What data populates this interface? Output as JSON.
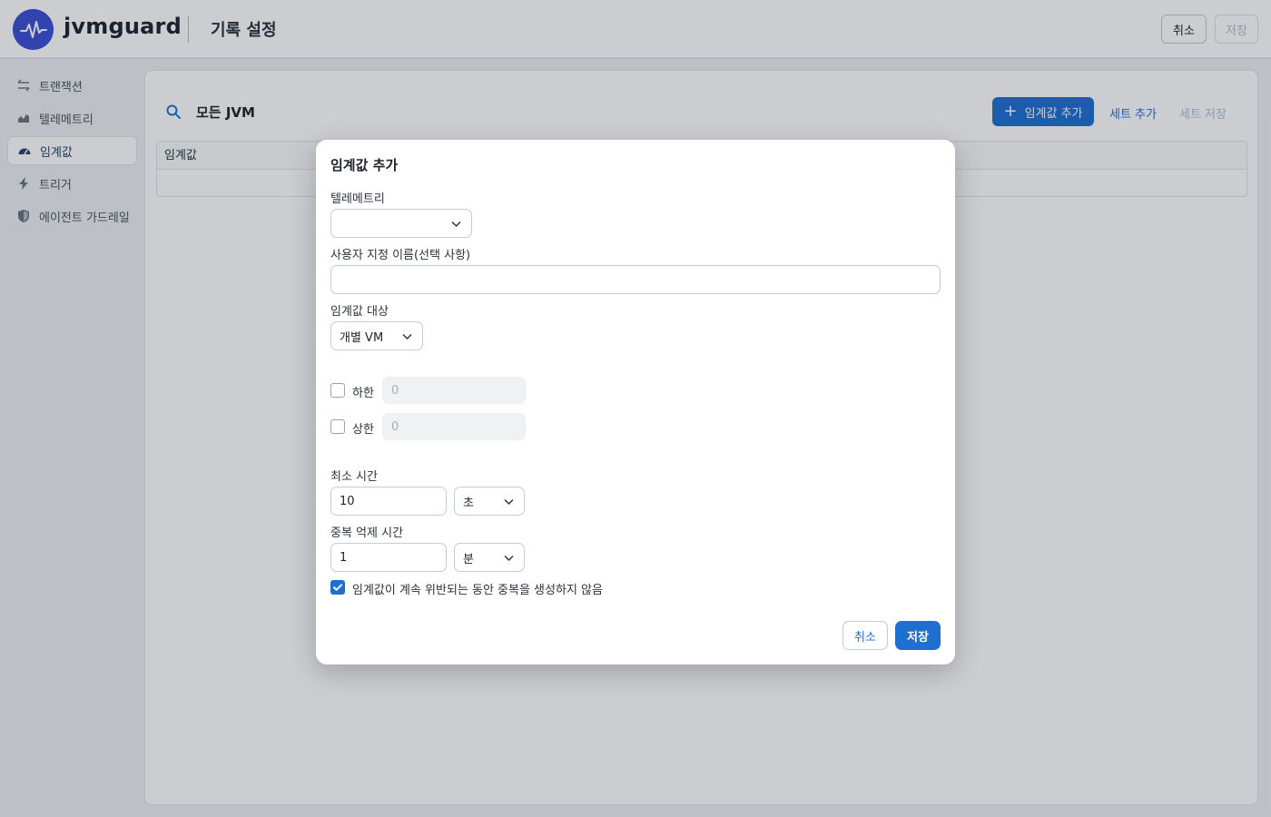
{
  "header": {
    "brand": "jvmguard",
    "title": "기록 설정",
    "cancel_label": "취소",
    "save_label": "저장"
  },
  "sidebar": {
    "items": [
      {
        "label": "트랜잭션",
        "icon": "transactions-icon",
        "active": false
      },
      {
        "label": "텔레메트리",
        "icon": "telemetry-chart-icon",
        "active": false
      },
      {
        "label": "임계값",
        "icon": "gauge-icon",
        "active": true
      },
      {
        "label": "트리거",
        "icon": "lightning-icon",
        "active": false
      },
      {
        "label": "에이전트 가드레일",
        "icon": "shield-icon",
        "active": false
      }
    ]
  },
  "main": {
    "title": "모든 JVM",
    "add_threshold_label": "임계값 추가",
    "add_set_label": "세트 추가",
    "save_set_label": "세트 저장",
    "table_header": "임계값"
  },
  "modal": {
    "title": "임계값 추가",
    "telemetry_label": "텔레메트리",
    "telemetry_value": "",
    "custom_name_label": "사용자 지정 이름(선택 사항)",
    "custom_name_value": "",
    "target_label": "임계값 대상",
    "target_value": "개별 VM",
    "lower_label": "하한",
    "lower_value": "0",
    "lower_checked": false,
    "upper_label": "상한",
    "upper_value": "0",
    "upper_checked": false,
    "min_time_label": "최소 시간",
    "min_time_value": "10",
    "min_time_unit": "초",
    "dedup_label": "중복 억제 시간",
    "dedup_value": "1",
    "dedup_unit": "분",
    "no_duplicate_label": "임계값이 계속 위반되는 동안 중복을 생성하지 않음",
    "no_duplicate_checked": true,
    "cancel_label": "취소",
    "save_label": "저장"
  },
  "colors": {
    "accent": "#1f6fd1",
    "logo": "#3b4fd6"
  }
}
